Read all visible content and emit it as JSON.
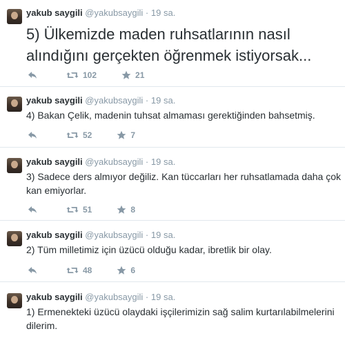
{
  "tweets": [
    {
      "name": "yakub saygili",
      "handle": "@yakubsaygili",
      "dot": "·",
      "time": "19 sa.",
      "text": "5) Ülkemizde maden ruhsatlarının nasıl alındığını gerçekten öğrenmek istiyorsak...",
      "retweets": "102",
      "favorites": "21"
    },
    {
      "name": "yakub saygili",
      "handle": "@yakubsaygili",
      "dot": "·",
      "time": "19 sa.",
      "text": "4) Bakan Çelik, madenin tuhsat almaması gerektiğinden bahsetmiş.",
      "retweets": "52",
      "favorites": "7"
    },
    {
      "name": "yakub saygili",
      "handle": "@yakubsaygili",
      "dot": "·",
      "time": "19 sa.",
      "text_line1": "3) Sadece ders almıyor değiliz. Kan tüccarları her ruhsatlamada daha çok",
      "text_line2": "kan emiyorlar.",
      "retweets": "51",
      "favorites": "8"
    },
    {
      "name": "yakub saygili",
      "handle": "@yakubsaygili",
      "dot": "·",
      "time": "19 sa.",
      "text": "2) Tüm milletimiz için üzücü olduğu kadar, ibretlik bir olay.",
      "retweets": "48",
      "favorites": "6"
    },
    {
      "name": "yakub saygili",
      "handle": "@yakubsaygili",
      "dot": "·",
      "time": "19 sa.",
      "text_line1": "1) Ermenekteki üzücü olaydaki işçilerimizin sağ salim kurtarılabilmelerini",
      "text_line2": "dilerim."
    }
  ],
  "icons": {
    "reply": "reply-icon",
    "retweet": "retweet-icon",
    "favorite": "star-icon"
  },
  "colors": {
    "text": "#292f33",
    "muted": "#8899a6",
    "divider": "#e1e8ed"
  }
}
